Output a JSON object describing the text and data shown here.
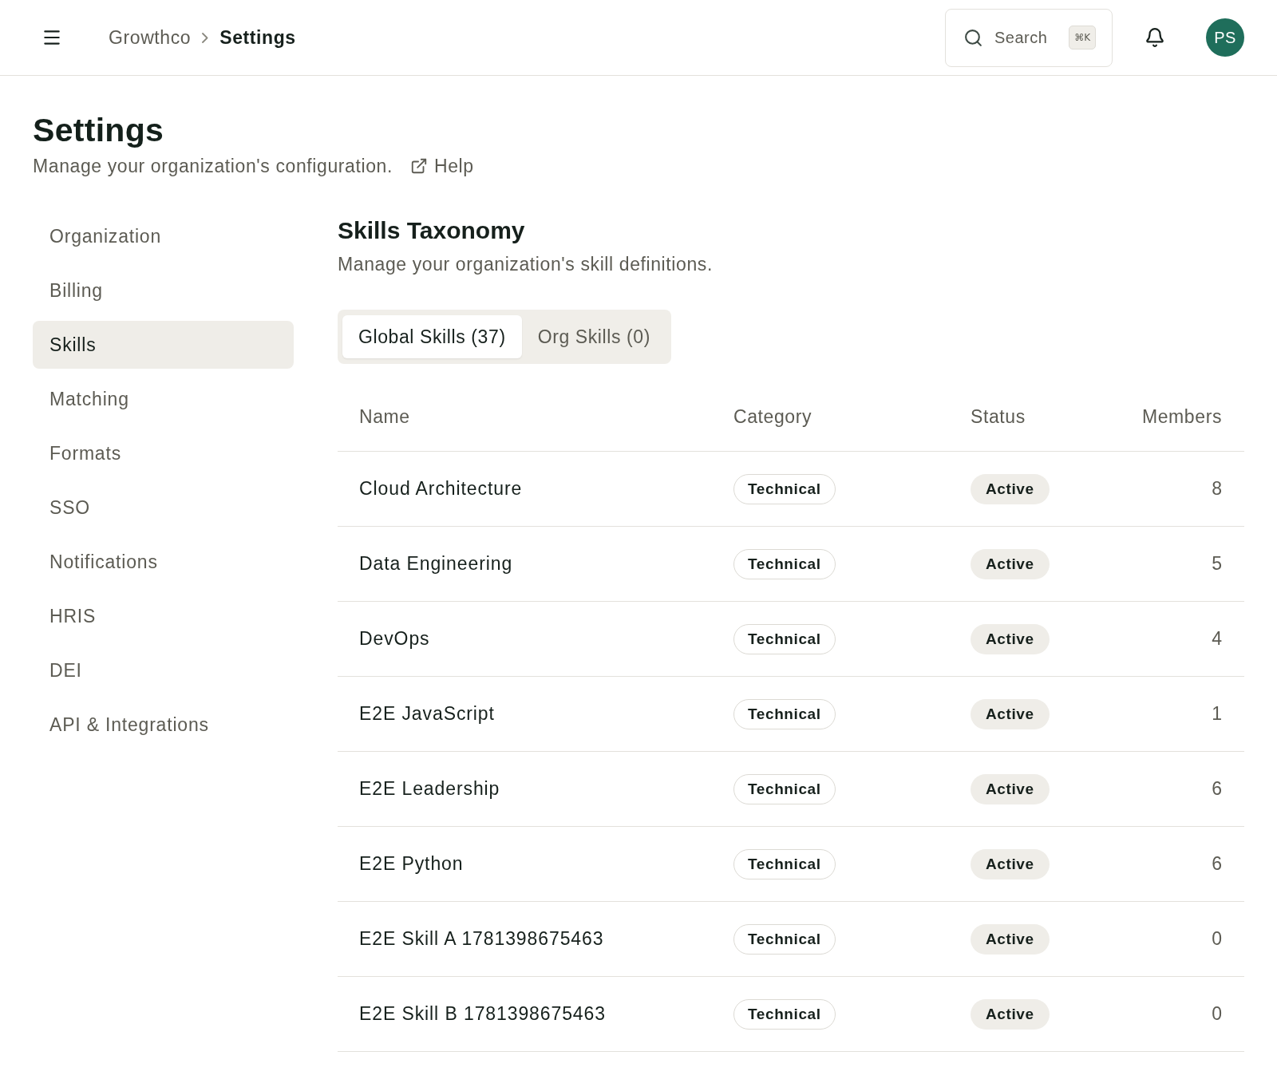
{
  "header": {
    "breadcrumb": [
      {
        "label": "Growthco",
        "current": false
      },
      {
        "label": "Settings",
        "current": true
      }
    ],
    "search": {
      "label": "Search",
      "shortcut": "⌘K"
    },
    "avatar": {
      "initials": "PS"
    }
  },
  "page": {
    "title": "Settings",
    "subtitle": "Manage your organization's configuration.",
    "help_link": "Help"
  },
  "sidebar": {
    "items": [
      {
        "label": "Organization",
        "selected": false
      },
      {
        "label": "Billing",
        "selected": false
      },
      {
        "label": "Skills",
        "selected": true
      },
      {
        "label": "Matching",
        "selected": false
      },
      {
        "label": "Formats",
        "selected": false
      },
      {
        "label": "SSO",
        "selected": false
      },
      {
        "label": "Notifications",
        "selected": false
      },
      {
        "label": "HRIS",
        "selected": false
      },
      {
        "label": "DEI",
        "selected": false
      },
      {
        "label": "API & Integrations",
        "selected": false
      }
    ]
  },
  "section": {
    "title": "Skills Taxonomy",
    "subtitle": "Manage your organization's skill definitions.",
    "tabs": [
      {
        "label": "Global Skills (37)",
        "selected": true
      },
      {
        "label": "Org Skills (0)",
        "selected": false
      }
    ]
  },
  "table": {
    "columns": [
      "Name",
      "Category",
      "Status",
      "Members"
    ],
    "rows": [
      {
        "name": "Cloud Architecture",
        "category": "Technical",
        "status": "Active",
        "members": "8"
      },
      {
        "name": "Data Engineering",
        "category": "Technical",
        "status": "Active",
        "members": "5"
      },
      {
        "name": "DevOps",
        "category": "Technical",
        "status": "Active",
        "members": "4"
      },
      {
        "name": "E2E JavaScript",
        "category": "Technical",
        "status": "Active",
        "members": "1"
      },
      {
        "name": "E2E Leadership",
        "category": "Technical",
        "status": "Active",
        "members": "6"
      },
      {
        "name": "E2E Python",
        "category": "Technical",
        "status": "Active",
        "members": "6"
      },
      {
        "name": "E2E Skill A 1781398675463",
        "category": "Technical",
        "status": "Active",
        "members": "0"
      },
      {
        "name": "E2E Skill B 1781398675463",
        "category": "Technical",
        "status": "Active",
        "members": "0"
      }
    ]
  }
}
